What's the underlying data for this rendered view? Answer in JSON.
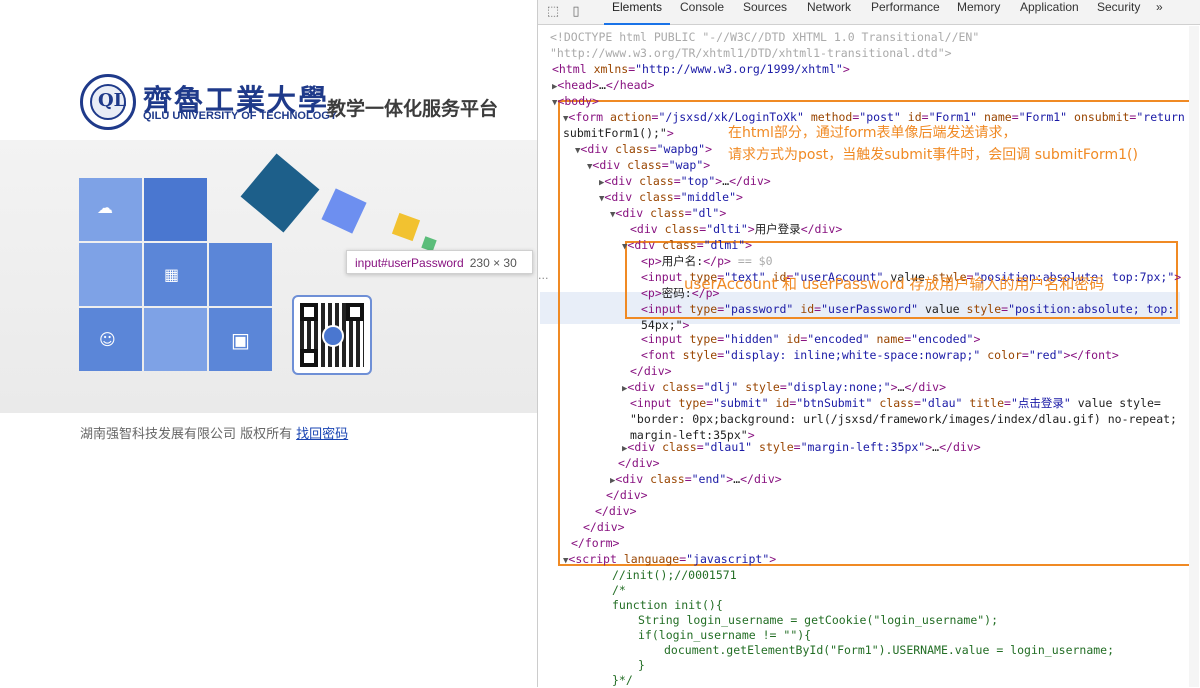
{
  "site": {
    "logo_emblem_text": "QL",
    "logo_cn": "齊魯工業大學",
    "logo_en": "QILU UNIVERSITY OF TECHNOLOGY",
    "slogan": "教学一体化服务平台",
    "footer_text": "湖南强智科技发展有限公司 版权所有",
    "footer_link": "找回密码",
    "tooltip_selector": "input#userPassword",
    "tooltip_size": "230 × 30"
  },
  "devtools": {
    "tabs": [
      "Elements",
      "Console",
      "Sources",
      "Network",
      "Performance",
      "Memory",
      "Application",
      "Security"
    ],
    "active_tab": "Elements",
    "more": "»",
    "annotations": {
      "a1": "在html部分，通过form表单像后端发送请求，",
      "a2": "请求方式为post，当触发submit事件时，会回调 submitForm1()",
      "a3": "userAccount 和 userPassword 存放用户输入的用户名和密码"
    },
    "lines": {
      "l0": "<!DOCTYPE html PUBLIC \"-//W3C//DTD XHTML 1.0 Transitional//EN\"",
      "l1": "\"http://www.w3.org/TR/xhtml1/DTD/xhtml1-transitional.dtd\">",
      "l2": "<html xmlns=\"http://www.w3.org/1999/xhtml\">",
      "l3": "▶<head>…</head>",
      "l4": "▼<body>",
      "l5": "▼<form action=\"/jsxsd/xk/LoginToXk\" method=\"post\" id=\"Form1\" name=\"Form1\" onsubmit=\"return",
      "l6": "submitForm1();\">",
      "l7": "▼<div class=\"wapbg\">",
      "l8": "▼<div class=\"wap\">",
      "l9": "▶<div class=\"top\">…</div>",
      "l10": "▼<div class=\"middle\">",
      "l11": "▼<div class=\"dl\">",
      "l12": "<div class=\"dlti\">用户登录</div>",
      "l13": "▼<div class=\"dlmi\">",
      "l14": "<p>用户名:</p> == $0",
      "l15": "<input type=\"text\" id=\"userAccount\" value style=\"position:absolute; top:7px;\">",
      "l16": "<p>密码:</p>",
      "l17": "<input type=\"password\" id=\"userPassword\" value style=\"position:absolute; top:",
      "l18": "54px;\">",
      "l19": "<input type=\"hidden\" id=\"encoded\" name=\"encoded\">",
      "l20": "<font style=\"display: inline;white-space:nowrap;\" color=\"red\"></font>",
      "l21": "</div>",
      "l22": "▶<div class=\"dlj\" style=\"display:none;\">…</div>",
      "l23": "<input type=\"submit\" id=\"btnSubmit\" class=\"dlau\" title=\"点击登录\" value style=",
      "l24": "\"border: 0px;background: url(/jsxsd/framework/images/index/dlau.gif) no-repeat;",
      "l25": "margin-left:35px\">",
      "l26": "▶<div class=\"dlau1\" style=\"margin-left:35px\">…</div>",
      "l27": "</div>",
      "l28": "▶<div class=\"end\">…</div>",
      "l29": "</div>",
      "l30": "</div>",
      "l31": "</div>",
      "l32": "</form>",
      "l33": "▼<script language=\"javascript\">",
      "l34": "//init();//0001571",
      "l35": "/*",
      "l36": "function init(){",
      "l37": "String login_username = getCookie(\"login_username\");",
      "l38": "if(login_username != \"\"){",
      "l39": "document.getElementById(\"Form1\").USERNAME.value = login_username;",
      "l40": "}",
      "l41": "}*/"
    },
    "dots": "···",
    "colors": {
      "tag": "#881280",
      "attr": "#994500",
      "value": "#1a1aa6",
      "comment": "#236e25",
      "annotation": "#f08a24",
      "active_tab": "#1a73e8"
    }
  }
}
